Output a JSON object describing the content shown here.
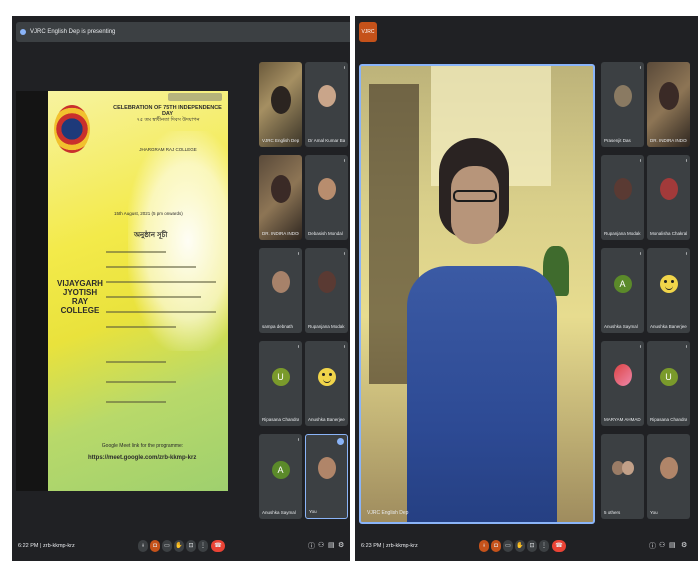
{
  "left": {
    "presenting_text": "VJRC English Dep is presenting",
    "slide": {
      "title": "CELEBRATION OF 75TH INDEPENDENCE DAY",
      "subtitle_line": "৭৫ তম স্বাধীনতা দিবস উদযাপন",
      "college_name": "JHARGRAM RAJ COLLEGE",
      "date_line": "15th August, 2021 (5 pm onwards)",
      "left_college": "VIJAYGARH JYOTISH RAY COLLEGE",
      "program_heading": "অনুষ্ঠান সূচী",
      "meet_line": "Google Meet link for the programme:",
      "meet_url": "https://meet.google.com/zrb-kkmp-krz"
    },
    "tiles": [
      {
        "name": "VJRC English Dep",
        "type": "video"
      },
      {
        "name": "Dr Amal Kumar Bane...",
        "type": "photo"
      },
      {
        "name": "DR. INDIRA INDORI",
        "type": "video"
      },
      {
        "name": "Debasish Mondal",
        "type": "photo"
      },
      {
        "name": "sampa debnath",
        "type": "photo"
      },
      {
        "name": "Rupanjana Modak",
        "type": "photo"
      },
      {
        "name": "Ripasana Chandra",
        "type": "letter",
        "letter": "U"
      },
      {
        "name": "Anushka Banerjee",
        "type": "face"
      },
      {
        "name": "Anushka Saymal",
        "type": "letter",
        "letter": "A"
      },
      {
        "name": "You",
        "type": "photo"
      }
    ],
    "bottom": {
      "time": "6:22 PM",
      "meeting_code": "zrb-kkmp-krz"
    }
  },
  "right": {
    "chip": "VJRC",
    "main_name": "VJRC English Dep",
    "tiles": [
      {
        "name": "Prasenjit Das",
        "type": "photo"
      },
      {
        "name": "DR. INDIRA INDORI",
        "type": "video"
      },
      {
        "name": "Rupanjana Modak",
        "type": "photo"
      },
      {
        "name": "Monalisha Chakraborty",
        "type": "photo"
      },
      {
        "name": "Anushka Saymal",
        "type": "letter",
        "letter": "A"
      },
      {
        "name": "Anushka Banerjee",
        "type": "face"
      },
      {
        "name": "MARYAM AHMAD",
        "type": "photo"
      },
      {
        "name": "Ripasana Chandra",
        "type": "letter",
        "letter": "U"
      },
      {
        "name": "5 others",
        "type": "photo"
      },
      {
        "name": "You",
        "type": "photo"
      }
    ],
    "bottom": {
      "time": "6:23 PM",
      "meeting_code": "zrb-kkmp-krz"
    }
  },
  "colors": {
    "end_call": "#ea4335",
    "present": "#c5521a",
    "active_border": "#8ab4f8",
    "letter_green": "#5b8a2a"
  }
}
